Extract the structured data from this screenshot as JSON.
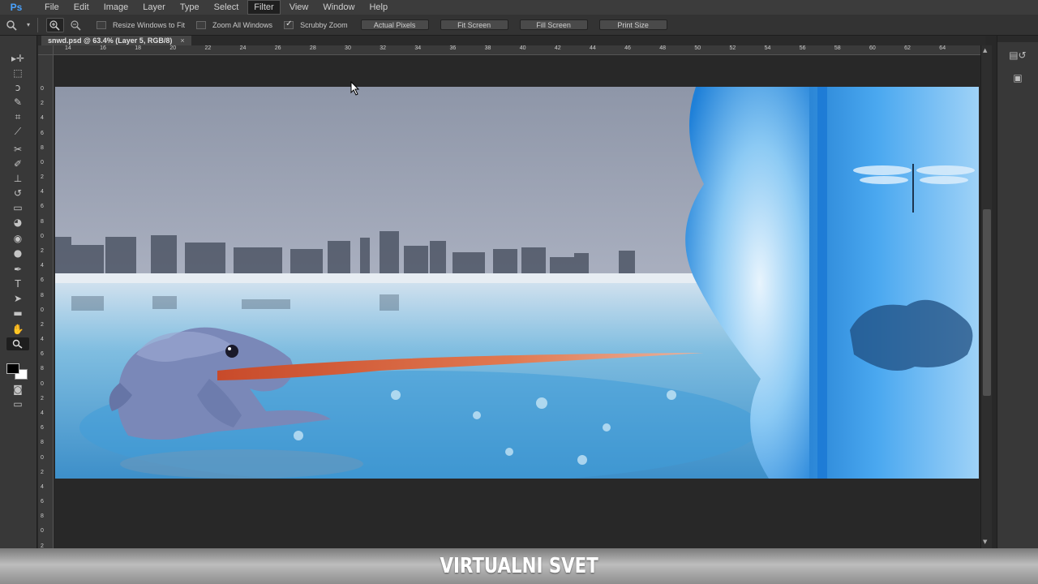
{
  "app": {
    "logo": "Ps"
  },
  "menu": {
    "items": [
      "File",
      "Edit",
      "Image",
      "Layer",
      "Type",
      "Select",
      "Filter",
      "View",
      "Window",
      "Help"
    ],
    "active": "Filter"
  },
  "options": {
    "tool_icon": "zoom-icon",
    "zoom_in_icon": "zoom-in-icon",
    "zoom_out_icon": "zoom-out-icon",
    "checkboxes": [
      {
        "label": "Resize Windows to Fit",
        "checked": false
      },
      {
        "label": "Zoom All Windows",
        "checked": false
      },
      {
        "label": "Scrubby Zoom",
        "checked": true
      }
    ],
    "buttons": [
      "Actual Pixels",
      "Fit Screen",
      "Fill Screen",
      "Print Size"
    ]
  },
  "document": {
    "tab_title": "snwd.psd @ 63.4% (Layer 5, RGB/8)",
    "close_glyph": "×"
  },
  "rulers": {
    "horizontal": [
      "14",
      "16",
      "18",
      "20",
      "22",
      "24",
      "26",
      "28",
      "30",
      "32",
      "34",
      "36",
      "38",
      "40",
      "42",
      "44",
      "46",
      "48",
      "50",
      "52",
      "54",
      "56",
      "58",
      "60",
      "62",
      "64"
    ],
    "vertical": [
      "0",
      "2",
      "4",
      "6",
      "8",
      "0",
      "2",
      "4",
      "6",
      "8",
      "0",
      "2",
      "4",
      "6",
      "8",
      "0",
      "2",
      "4",
      "6",
      "8",
      "0",
      "2",
      "4",
      "6",
      "8",
      "0",
      "2",
      "4",
      "6",
      "8",
      "0",
      "2",
      "4"
    ]
  },
  "tools": [
    "move-icon",
    "marquee-icon",
    "lasso-icon",
    "quick-select-icon",
    "crop-icon",
    "eyedropper-icon",
    "healing-brush-icon",
    "brush-icon",
    "clone-stamp-icon",
    "history-brush-icon",
    "eraser-icon",
    "paint-bucket-icon",
    "blur-icon",
    "dodge-icon",
    "pen-icon",
    "type-icon",
    "path-select-icon",
    "rectangle-icon",
    "hand-icon",
    "zoom-icon"
  ],
  "colors": {
    "foreground": "#000000",
    "background": "#ffffff",
    "accent": "#4aa3ff"
  },
  "banner": {
    "text": "VIRTUALNI SVET"
  }
}
